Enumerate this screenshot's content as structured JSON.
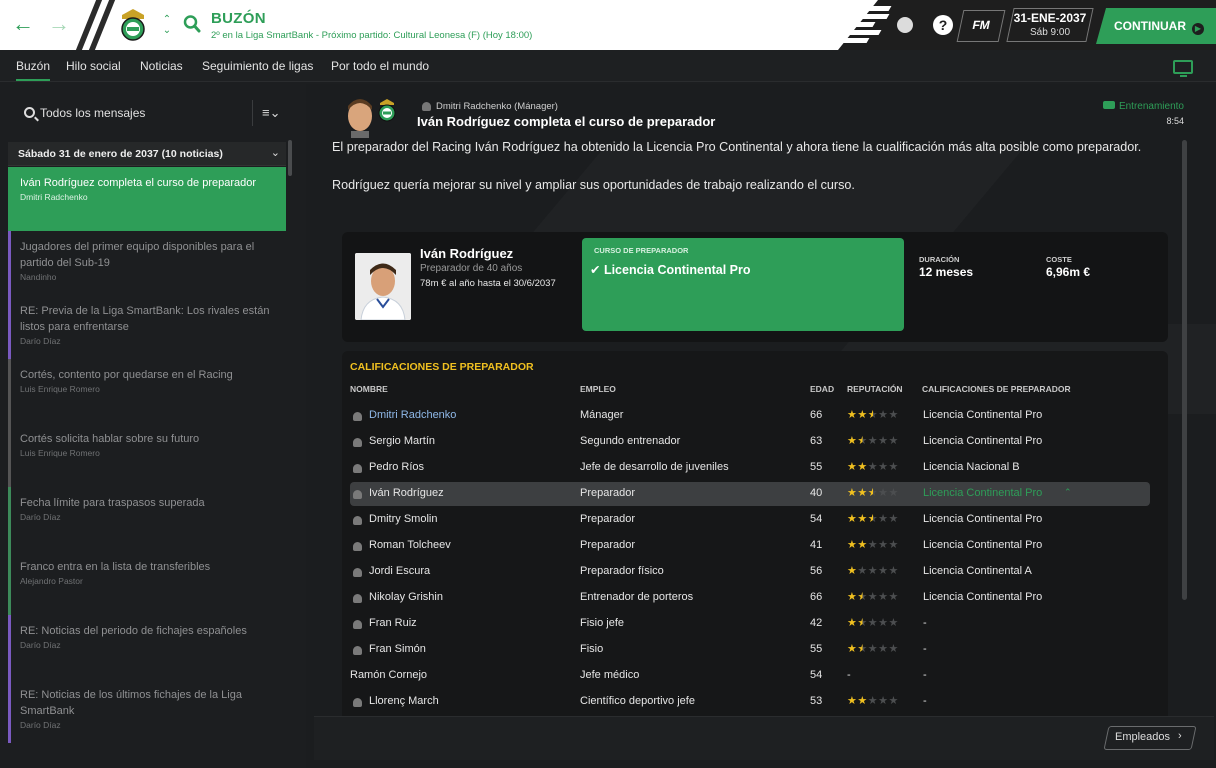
{
  "header": {
    "title": "BUZÓN",
    "subtitle": "2º en la Liga SmartBank - Próximo partido: Cultural Leonesa (F) (Hoy 18:00)",
    "badge": "FM",
    "date": "31-ENE-2037",
    "day_time": "Sáb 9:00",
    "continue_label": "CONTINUAR",
    "help": "?",
    "accent": "#2e9e58"
  },
  "tabs": [
    {
      "label": "Buzón",
      "active": true
    },
    {
      "label": "Hilo social"
    },
    {
      "label": "Noticias"
    },
    {
      "label": "Seguimiento de ligas"
    },
    {
      "label": "Por todo el mundo"
    }
  ],
  "inbox": {
    "filter_label": "Todos los mensajes",
    "group_label": "Sábado 31 de enero de 2037 (10 noticias)",
    "messages": [
      {
        "title": "Iván Rodríguez completa el curso de preparador",
        "sender": "Dmitri Radchenko",
        "selected": true
      },
      {
        "title": "Jugadores del primer equipo disponibles para el partido del Sub-19",
        "sender": "Nandinho"
      },
      {
        "title": "RE: Previa de la Liga SmartBank: Los rivales están listos para enfrentarse",
        "sender": "Darío Díaz"
      },
      {
        "title": "Cortés, contento por quedarse en el Racing",
        "sender": "Luis Enrique Romero"
      },
      {
        "title": "Cortés solicita hablar sobre su futuro",
        "sender": "Luis Enrique Romero"
      },
      {
        "title": "Fecha límite para traspasos superada",
        "sender": "Darío Díaz"
      },
      {
        "title": "Franco entra en la lista de transferibles",
        "sender": "Alejandro Pastor"
      },
      {
        "title": "RE: Noticias del periodo de fichajes españoles",
        "sender": "Darío Díaz"
      },
      {
        "title": "RE: Noticias de los últimos fichajes de la Liga SmartBank",
        "sender": "Darío Díaz"
      }
    ]
  },
  "message": {
    "sender": "Dmitri Radchenko  (Mánager)",
    "title": "Iván Rodríguez completa el curso de preparador",
    "category": "Entrenamiento",
    "time": "8:54",
    "paragraph1": "El preparador del Racing Iván Rodríguez ha obtenido la Licencia Pro Continental y ahora tiene la cualificación más alta posible como preparador.",
    "paragraph2": "Rodríguez quería mejorar su nivel y ampliar sus oportunidades de trabajo realizando el curso."
  },
  "card": {
    "name": "Iván Rodríguez",
    "role": "Preparador de 40 años",
    "contract": "78m € al año hasta el 30/6/2037",
    "course_label": "CURSO DE PREPARADOR",
    "course_name": "✔ Licencia Continental Pro",
    "duration_label": "DURACIÓN",
    "duration_value": "12 meses",
    "cost_label": "COSTE",
    "cost_value": "6,96m €"
  },
  "qualifications": {
    "title": "CALIFICACIONES DE PREPARADOR",
    "headers": {
      "name": "NOMBRE",
      "job": "EMPLEO",
      "age": "EDAD",
      "reputation": "REPUTACIÓN",
      "quals": "CALIFICACIONES DE PREPARADOR"
    },
    "rows": [
      {
        "name": "Dmitri Radchenko",
        "job": "Mánager",
        "age": "66",
        "stars": 2.5,
        "qual": "Licencia Continental Pro",
        "icon": true,
        "link": true
      },
      {
        "name": "Sergio Martín",
        "job": "Segundo entrenador",
        "age": "63",
        "stars": 1.5,
        "qual": "Licencia Continental Pro",
        "icon": true
      },
      {
        "name": "Pedro Ríos",
        "job": "Jefe de desarrollo de juveniles",
        "age": "55",
        "stars": 2,
        "qual": "Licencia Nacional B",
        "icon": true
      },
      {
        "name": "Iván Rodríguez",
        "job": "Preparador",
        "age": "40",
        "stars": 2.5,
        "qual": "Licencia Continental Pro",
        "icon": true,
        "selected": true
      },
      {
        "name": "Dmitry Smolin",
        "job": "Preparador",
        "age": "54",
        "stars": 2.5,
        "qual": "Licencia Continental Pro",
        "icon": true
      },
      {
        "name": "Roman Tolcheev",
        "job": "Preparador",
        "age": "41",
        "stars": 2,
        "qual": "Licencia Continental Pro",
        "icon": true
      },
      {
        "name": "Jordi Escura",
        "job": "Preparador físico",
        "age": "56",
        "stars": 1,
        "qual": "Licencia Continental A",
        "icon": true
      },
      {
        "name": "Nikolay Grishin",
        "job": "Entrenador de porteros",
        "age": "66",
        "stars": 1.5,
        "qual": "Licencia Continental Pro",
        "icon": true
      },
      {
        "name": "Fran Ruiz",
        "job": "Fisio jefe",
        "age": "42",
        "stars": 1.5,
        "qual": "-",
        "icon": true
      },
      {
        "name": "Fran Simón",
        "job": "Fisio",
        "age": "55",
        "stars": 1.5,
        "qual": "-",
        "icon": true
      },
      {
        "name": "Ramón Cornejo",
        "job": "Jefe médico",
        "age": "54",
        "stars": null,
        "stars_text": "-",
        "qual": "-",
        "icon": false
      },
      {
        "name": "Llorenç March",
        "job": "Científico deportivo jefe",
        "age": "53",
        "stars": 2,
        "qual": "-",
        "icon": true
      }
    ]
  },
  "footer": {
    "employees_label": "Empleados"
  }
}
